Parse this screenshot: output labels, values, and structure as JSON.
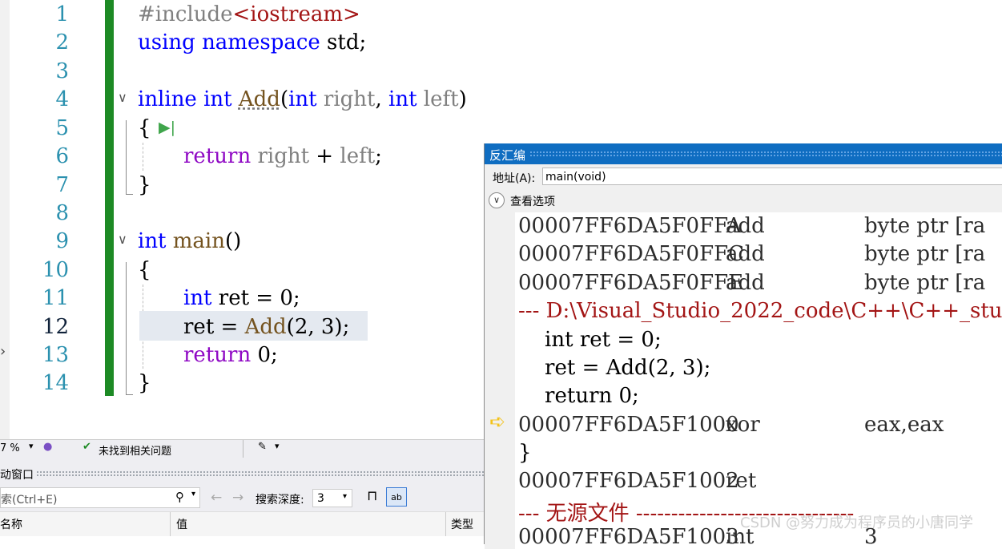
{
  "editor": {
    "line_numbers": [
      "1",
      "2",
      "3",
      "4",
      "5",
      "6",
      "7",
      "8",
      "9",
      "10",
      "11",
      "12",
      "13",
      "14"
    ],
    "current_line": "12",
    "lines": {
      "l1_include": "#include",
      "l1_header": "<iostream>",
      "l2_using": "using",
      "l2_namespace": "namespace",
      "l2_rest": " std;",
      "l4_inline": "inline",
      "l4_int1": "int",
      "l4_add": "Add",
      "l4_paren": "(",
      "l4_int2": "int",
      "l4_right": "right",
      "l4_comma": ", ",
      "l4_int3": "int",
      "l4_left": "left",
      "l4_close": ")",
      "l5_brace": "{",
      "l6_return": "return",
      "l6_right": "right",
      "l6_plus": " + ",
      "l6_left": "left",
      "l6_semi": ";",
      "l7_brace": "}",
      "l9_int": "int",
      "l9_main": "main",
      "l9_parens": "()",
      "l10_brace": "{",
      "l11_int": "int",
      "l11_rest": " ret = 0;",
      "l12_ret": "ret",
      "l12_eq": " = ",
      "l12_add": "Add",
      "l12_args": "(2, 3);",
      "l13_return": "return",
      "l13_rest": " 0;",
      "l14_brace": "}"
    },
    "colors": {
      "keyword": "#0000ff",
      "control": "#8f08c4",
      "function": "#74531f",
      "parameter": "#808080",
      "change_bar": "#1d8a24"
    }
  },
  "disassembly": {
    "title": "反汇编",
    "address_label": "地址(A):",
    "address_value": "main(void)",
    "view_options": "查看选项",
    "lines": [
      {
        "kind": "asm",
        "addr": "00007FF6DA5F0FFA",
        "op": "add",
        "args": "byte ptr [ra"
      },
      {
        "kind": "asm",
        "addr": "00007FF6DA5F0FFC",
        "op": "add",
        "args": "byte ptr [ra"
      },
      {
        "kind": "asm",
        "addr": "00007FF6DA5F0FFE",
        "op": "add",
        "args": "byte ptr [ra"
      },
      {
        "kind": "sep",
        "text": "--- D:\\Visual_Studio_2022_code\\C++\\C++_stu"
      },
      {
        "kind": "src",
        "text": "    int ret = 0;"
      },
      {
        "kind": "src",
        "text": "    ret = Add(2, 3);"
      },
      {
        "kind": "src",
        "text": "    return 0;"
      },
      {
        "kind": "asm",
        "addr": "00007FF6DA5F1000",
        "op": "xor",
        "args": "eax,eax"
      },
      {
        "kind": "src",
        "text": "}"
      },
      {
        "kind": "asm",
        "addr": "00007FF6DA5F1002",
        "op": "ret",
        "args": ""
      },
      {
        "kind": "sep",
        "text": "--- 无源文件 -------------------------------"
      },
      {
        "kind": "asm",
        "addr": "00007FF6DA5F1003",
        "op": "int",
        "args": "3"
      }
    ]
  },
  "statusbar": {
    "zoom": "7 %",
    "issues": "未找到相关问题"
  },
  "auto_window": {
    "title": "动窗口",
    "search_placeholder": "索(Ctrl+E)",
    "search_depth_label": "搜索深度:",
    "search_depth_value": "3",
    "col_name": "名称",
    "col_value": "值",
    "col_type": "类型"
  },
  "watermark": "CSDN @努力成为程序员的小唐同学"
}
